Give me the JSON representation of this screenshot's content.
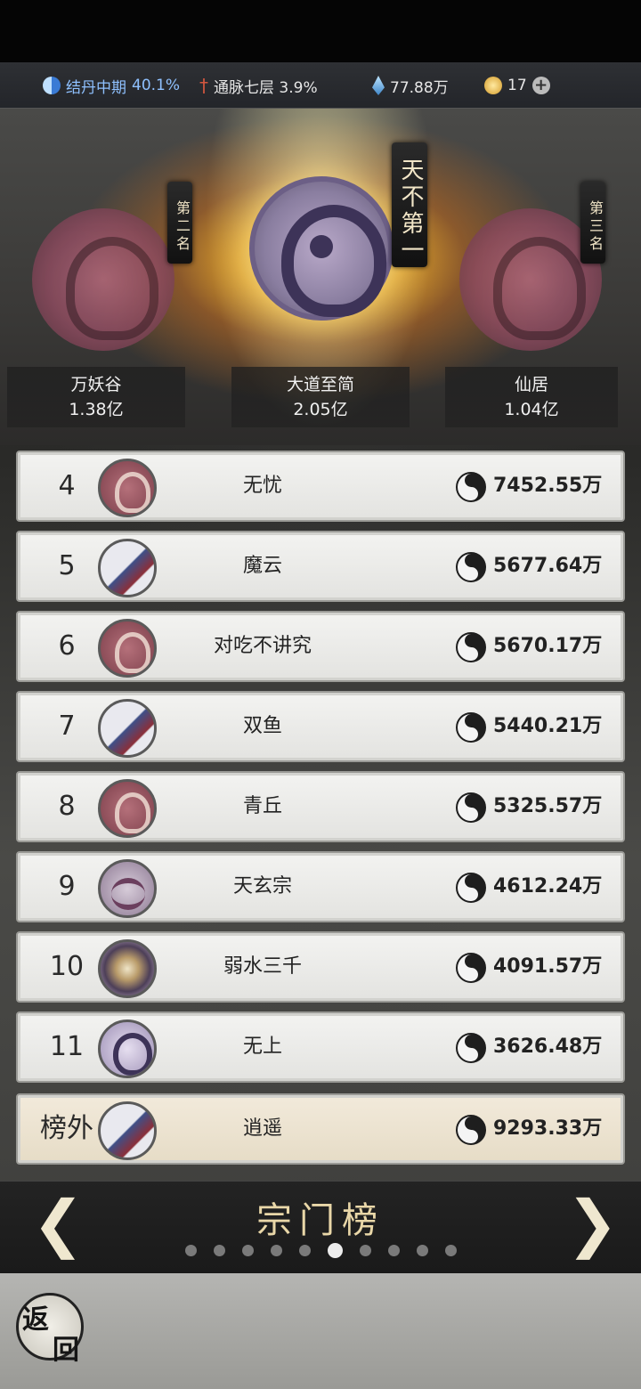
{
  "resources": {
    "realm": {
      "name": "结丹中期",
      "value": "40.1%",
      "icon": "taiji-blue-icon"
    },
    "meridian": {
      "label": "通脉七层 3.9%",
      "icon": "sword-icon"
    },
    "spirit_stone": {
      "value": "77.88万",
      "icon": "crystal-icon"
    },
    "gold": {
      "value": "17",
      "icon": "coin-icon"
    }
  },
  "podium": {
    "first": {
      "plaque": "天不第一",
      "name": "大道至简",
      "score": "2.05亿"
    },
    "second": {
      "plaque": "第二名",
      "name": "万妖谷",
      "score": "1.38亿"
    },
    "third": {
      "plaque": "第三名",
      "name": "仙居",
      "score": "1.04亿"
    }
  },
  "ranks": [
    {
      "rank": "4",
      "name": "无忧",
      "score": "7452.55万"
    },
    {
      "rank": "5",
      "name": "魔云",
      "score": "5677.64万"
    },
    {
      "rank": "6",
      "name": "对吃不讲究",
      "score": "5670.17万"
    },
    {
      "rank": "7",
      "name": "双鱼",
      "score": "5440.21万"
    },
    {
      "rank": "8",
      "name": "青丘",
      "score": "5325.57万"
    },
    {
      "rank": "9",
      "name": "天玄宗",
      "score": "4612.24万"
    },
    {
      "rank": "10",
      "name": "弱水三千",
      "score": "4091.57万"
    },
    {
      "rank": "11",
      "name": "无上",
      "score": "3626.48万"
    }
  ],
  "self_rank": {
    "rank": "榜外",
    "name": "逍遥",
    "score": "9293.33万"
  },
  "pager": {
    "title": "宗门榜",
    "prev": "❮",
    "next": "❯",
    "active_page": 6,
    "total_pages": 10
  },
  "back_button": {
    "char1": "返",
    "char2": "回"
  },
  "colors": {
    "accent_gold": "#e9d7a8",
    "realm_blue": "#8fc1ff",
    "row_bg": "#f3f3f1",
    "self_row_bg": "#f2eadb"
  }
}
